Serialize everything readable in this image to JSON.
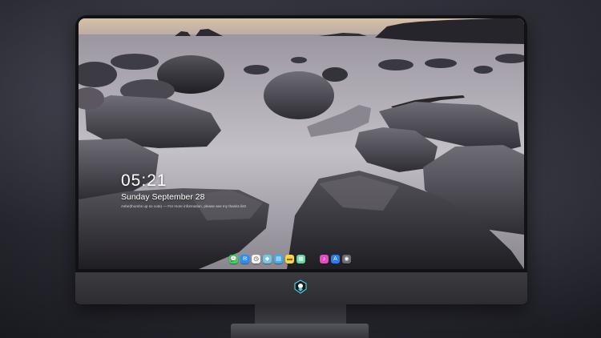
{
  "lock_screen": {
    "time": "05:21",
    "date": "Sunday September 28",
    "notice": "Ashe(thumbs up so cute) — For more information, please see my thanks list!"
  },
  "dock": {
    "apps": [
      {
        "name": "messages-icon",
        "color": "#3fd35a",
        "glyph": "💬"
      },
      {
        "name": "mail-icon",
        "color": "#2e8cf2",
        "glyph": "✉"
      },
      {
        "name": "clock-app-icon",
        "color": "#f2f2f2",
        "glyph": "◷"
      },
      {
        "name": "maps-icon",
        "color": "#7bc4e0",
        "glyph": "◆"
      },
      {
        "name": "files-icon",
        "color": "#48a8e8",
        "glyph": "▤"
      },
      {
        "name": "notes-icon",
        "color": "#f6d34a",
        "glyph": "▬"
      },
      {
        "name": "photos-icon",
        "color": "#6fd0a0",
        "glyph": "▦"
      },
      {
        "name": "music-icon",
        "color": "#e04ec2",
        "glyph": "♪"
      },
      {
        "name": "app-store-icon",
        "color": "#2a7cf0",
        "glyph": "A"
      },
      {
        "name": "camera-icon",
        "color": "#6c6c72",
        "glyph": "◉"
      }
    ]
  },
  "colors": {
    "monitor_bezel": "#121214",
    "monitor_chin": "#35353a",
    "logo_accent": "#4ec8e0"
  }
}
